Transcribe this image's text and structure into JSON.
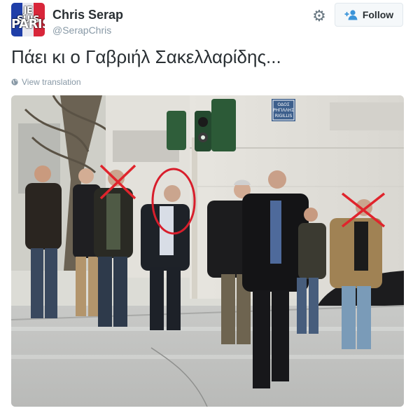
{
  "user": {
    "avatar_line1": "JE SUIS",
    "avatar_line2": "PARIS",
    "fullname": "Chris Serap",
    "handle": "@SerapChris"
  },
  "actions": {
    "settings_icon": "gear-icon",
    "follow_icon": "add-person-icon",
    "follow_label": "Follow"
  },
  "tweet": {
    "text": "Πάει κι ο Γαβριήλ Σακελλαρίδης...",
    "translate_icon": "globe-icon",
    "translate_label": "View translation"
  },
  "photo": {
    "street_sign": "ΟΔΟΣ\nΡΗΓΙΛΛΗΣ\nRIGILLIS",
    "colors": {
      "circle_annotation": "#d81e2c",
      "cross_annotation": "#e0242c",
      "follow_icon": "#3b94d9"
    }
  }
}
